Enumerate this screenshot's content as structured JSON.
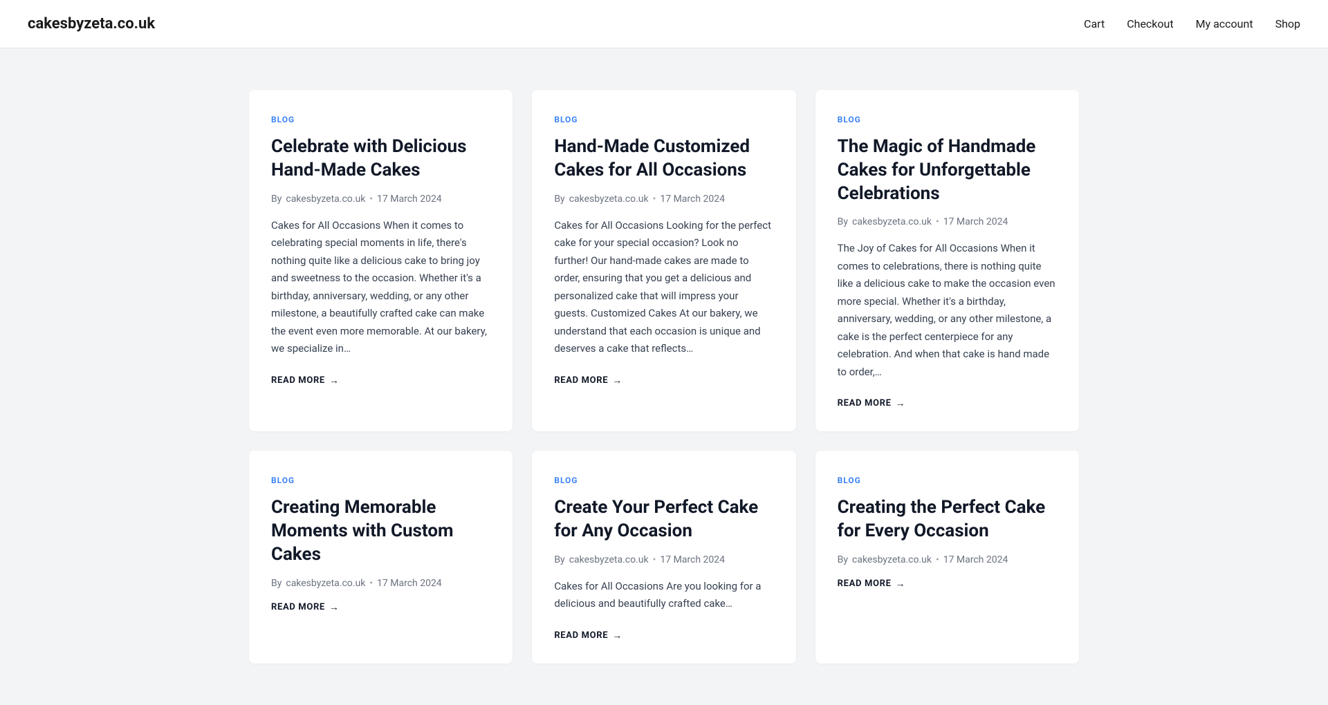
{
  "site": {
    "logo": "cakesbyzeta.co.uk"
  },
  "nav": {
    "items": [
      {
        "label": "Cart",
        "id": "cart"
      },
      {
        "label": "Checkout",
        "id": "checkout"
      },
      {
        "label": "My account",
        "id": "my-account"
      },
      {
        "label": "Shop",
        "id": "shop"
      }
    ]
  },
  "posts": [
    {
      "id": "post-1",
      "category": "BLOG",
      "title": "Celebrate with Delicious Hand-Made Cakes",
      "author": "cakesbyzeta.co.uk",
      "date": "17 March 2024",
      "excerpt": "Cakes for All Occasions When it comes to celebrating special moments in life, there's nothing quite like a delicious cake to bring joy and sweetness to the occasion. Whether it's a birthday, anniversary, wedding, or any other milestone, a beautifully crafted cake can make the event even more memorable. At our bakery, we specialize in…",
      "read_more": "READ MORE"
    },
    {
      "id": "post-2",
      "category": "BLOG",
      "title": "Hand-Made Customized Cakes for All Occasions",
      "author": "cakesbyzeta.co.uk",
      "date": "17 March 2024",
      "excerpt": "Cakes for All Occasions Looking for the perfect cake for your special occasion? Look no further! Our hand-made cakes are made to order, ensuring that you get a delicious and personalized cake that will impress your guests. Customized Cakes At our bakery, we understand that each occasion is unique and deserves a cake that reflects…",
      "read_more": "READ MORE"
    },
    {
      "id": "post-3",
      "category": "BLOG",
      "title": "The Magic of Handmade Cakes for Unforgettable Celebrations",
      "author": "cakesbyzeta.co.uk",
      "date": "17 March 2024",
      "excerpt": "The Joy of Cakes for All Occasions When it comes to celebrations, there is nothing quite like a delicious cake to make the occasion even more special. Whether it's a birthday, anniversary, wedding, or any other milestone, a cake is the perfect centerpiece for any celebration. And when that cake is hand made to order,…",
      "read_more": "READ MORE"
    },
    {
      "id": "post-4",
      "category": "BLOG",
      "title": "Creating Memorable Moments with Custom Cakes",
      "author": "cakesbyzeta.co.uk",
      "date": "17 March 2024",
      "excerpt": "",
      "read_more": "READ MORE"
    },
    {
      "id": "post-5",
      "category": "BLOG",
      "title": "Create Your Perfect Cake for Any Occasion",
      "author": "cakesbyzeta.co.uk",
      "date": "17 March 2024",
      "excerpt": "Cakes for All Occasions Are you looking for a delicious and beautifully crafted cake…",
      "read_more": "READ MORE"
    },
    {
      "id": "post-6",
      "category": "BLOG",
      "title": "Creating the Perfect Cake for Every Occasion",
      "author": "cakesbyzeta.co.uk",
      "date": "17 March 2024",
      "excerpt": "",
      "read_more": "READ MORE"
    }
  ]
}
